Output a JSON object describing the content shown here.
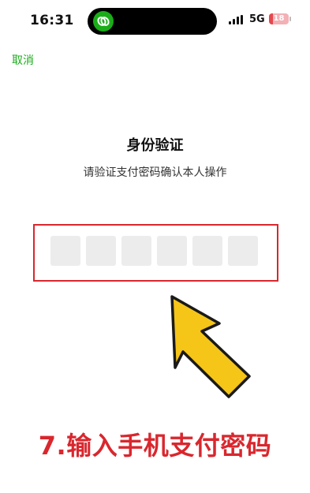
{
  "status_bar": {
    "time": "16:31",
    "island_app_icon": "wechat-pay-icon",
    "network": "5G",
    "battery": "18",
    "battery_level_percent": 18,
    "signal_bars": 4
  },
  "nav": {
    "cancel_label": "取消"
  },
  "auth": {
    "title": "身份验证",
    "subtitle": "请验证支付密码确认本人操作",
    "pin_length": 6,
    "entered_digits": 0
  },
  "annotation": {
    "caption": "7.输入手机支付密码",
    "highlight_color": "#d9272e",
    "arrow_color": "#f5c518"
  },
  "colors": {
    "accent": "#1aad19",
    "pin_cell": "#ececec"
  }
}
